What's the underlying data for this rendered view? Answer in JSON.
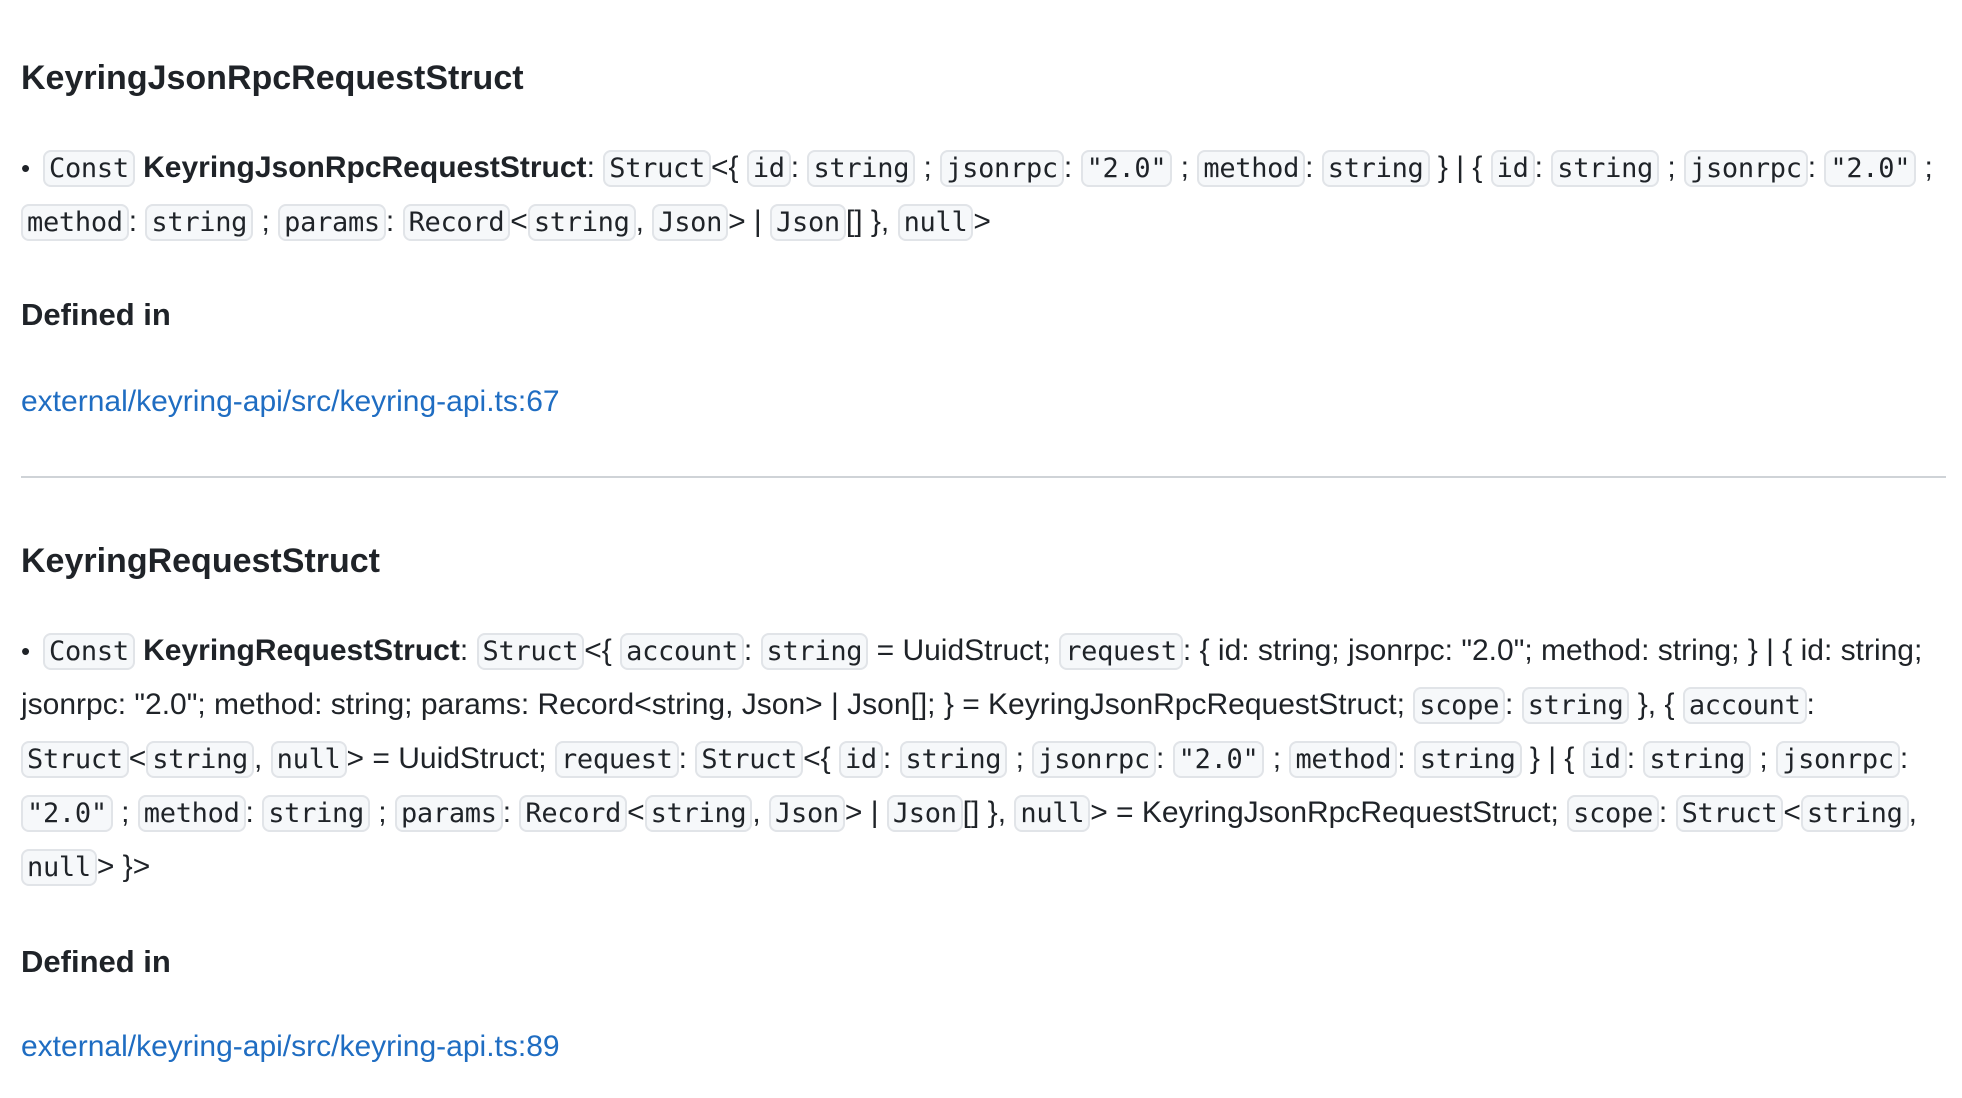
{
  "sections": [
    {
      "title": "KeyringJsonRpcRequestStruct",
      "defined_in_label": "Defined in",
      "source_link": "external/keyring-api/src/keyring-api.ts:67"
    },
    {
      "title": "KeyringRequestStruct",
      "defined_in_label": "Defined in",
      "source_link": "external/keyring-api/src/keyring-api.ts:89"
    }
  ],
  "bullet": "•",
  "kw": {
    "const": "Const",
    "struct": "Struct",
    "record": "Record",
    "string": "string",
    "json": "Json",
    "null": "null",
    "id": "id",
    "jsonrpc": "jsonrpc",
    "version": "\"2.0\"",
    "method": "method",
    "params": "params",
    "account": "account",
    "request": "request",
    "scope": "scope"
  },
  "sig2_text": {
    "uuid_struct": "UuidStruct;",
    "request_inline": "{ id: string; jsonrpc: \"2.0\"; method: string; } | { id: string; jsonrpc: \"2.0\"; method: string; params: Record<string, Json> | Json[]; } = KeyringJsonRpcRequestStruct;",
    "keyring_ref": "KeyringJsonRpcRequestStruct;"
  }
}
